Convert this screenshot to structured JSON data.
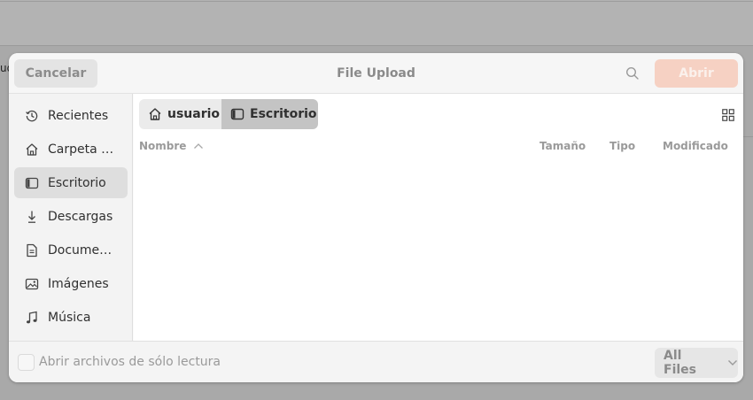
{
  "dialog": {
    "title": "File Upload",
    "cancel_label": "Cancelar",
    "open_label": "Abrir"
  },
  "sidebar": {
    "items": [
      {
        "label": "Recientes",
        "icon": "clock-icon"
      },
      {
        "label": "Carpeta …",
        "icon": "home-icon"
      },
      {
        "label": "Escritorio",
        "icon": "desktop-icon",
        "active": true
      },
      {
        "label": "Descargas",
        "icon": "download-icon"
      },
      {
        "label": "Docume…",
        "icon": "document-icon"
      },
      {
        "label": "Imágenes",
        "icon": "image-icon"
      },
      {
        "label": "Música",
        "icon": "music-icon"
      }
    ]
  },
  "breadcrumb": {
    "home": "usuario",
    "current": "Escritorio"
  },
  "columns": {
    "name": "Nombre",
    "size": "Tamaño",
    "type": "Tipo",
    "modified": "Modificado"
  },
  "footer": {
    "readonly_label": "Abrir archivos de sólo lectura",
    "filter_label": "All Files"
  },
  "colors": {
    "accent_disabled": "#f6d1c3",
    "active_item": "#dedede",
    "current_crumb": "#c4c4c4"
  }
}
